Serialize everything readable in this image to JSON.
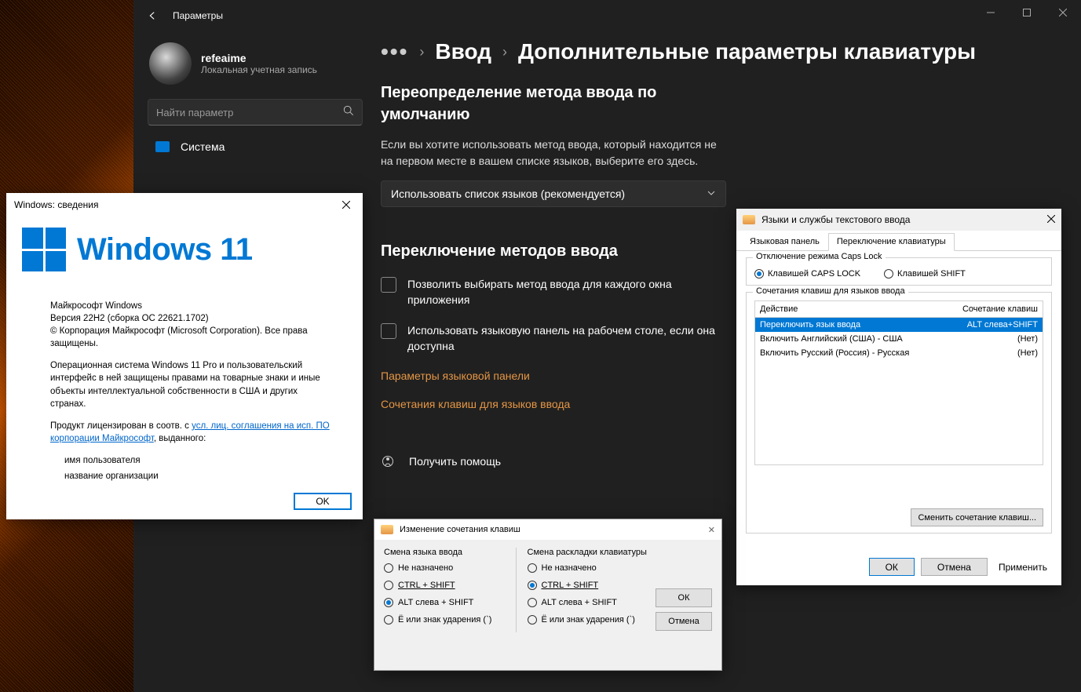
{
  "settings": {
    "title": "Параметры",
    "user": {
      "name": "refeaime",
      "sub": "Локальная учетная запись"
    },
    "search_placeholder": "Найти параметр",
    "nav": {
      "system": "Система"
    },
    "breadcrumb": {
      "lvl1": "Ввод",
      "lvl2": "Дополнительные параметры клавиатуры"
    },
    "section1": {
      "heading": "Переопределение метода ввода по умолчанию",
      "desc": "Если вы хотите использовать метод ввода, который находится не на первом месте в вашем списке языков, выберите его здесь.",
      "dropdown": "Использовать список языков (рекомендуется)"
    },
    "section2": {
      "heading": "Переключение методов ввода",
      "check1": "Позволить выбирать метод ввода для каждого окна приложения",
      "check2": "Использовать языковую панель на рабочем столе, если она доступна",
      "link1": "Параметры языковой панели",
      "link2": "Сочетания клавиш для языков ввода"
    },
    "help": "Получить помощь"
  },
  "winver": {
    "title": "Windows: сведения",
    "logo_text": "Windows 11",
    "ms_windows": "Майкрософт Windows",
    "version": "Версия 22H2 (сборка ОС 22621.1702)",
    "copyright": "© Корпорация Майкрософт (Microsoft Corporation). Все права защищены.",
    "edition": "Операционная система Windows 11 Pro и пользовательский интерфейс в ней защищены правами на товарные знаки и иные объекты интеллектуальной собственности в США и других странах.",
    "license_prefix": "Продукт лицензирован в соотв. с ",
    "license_link1": "усл. лиц. соглашения на исп. ПО корпорации Майкрософт",
    "license_suffix": ", выданного:",
    "user_label": "имя пользователя",
    "org_label": "название организации",
    "ok": "OK"
  },
  "text_services": {
    "title": "Языки и службы текстового ввода",
    "tab1": "Языковая панель",
    "tab2": "Переключение клавиатуры",
    "caps_group": "Отключение режима Caps Lock",
    "caps_opt1": "Клавишей CAPS LOCK",
    "caps_opt2": "Клавишей SHIFT",
    "shortcuts_group": "Сочетания клавиш для языков ввода",
    "col_action": "Действие",
    "col_shortcut": "Сочетание клавиш",
    "rows": [
      {
        "action": "Переключить язык ввода",
        "shortcut": "ALT слева+SHIFT"
      },
      {
        "action": "Включить Английский (США) - США",
        "shortcut": "(Нет)"
      },
      {
        "action": "Включить Русский (Россия) - Русская",
        "shortcut": "(Нет)"
      }
    ],
    "change_btn": "Сменить сочетание клавиш...",
    "ok": "ОК",
    "cancel": "Отмена",
    "apply": "Применить"
  },
  "shortcut_dlg": {
    "title": "Изменение сочетания клавиш",
    "col1": "Смена языка ввода",
    "col2": "Смена раскладки клавиатуры",
    "opt_none": "Не назначено",
    "opt_ctrl": "CTRL + SHIFT",
    "opt_alt": "ALT слева + SHIFT",
    "opt_tilde": "Ё или знак ударения (`)",
    "ok": "ОК",
    "cancel": "Отмена"
  }
}
